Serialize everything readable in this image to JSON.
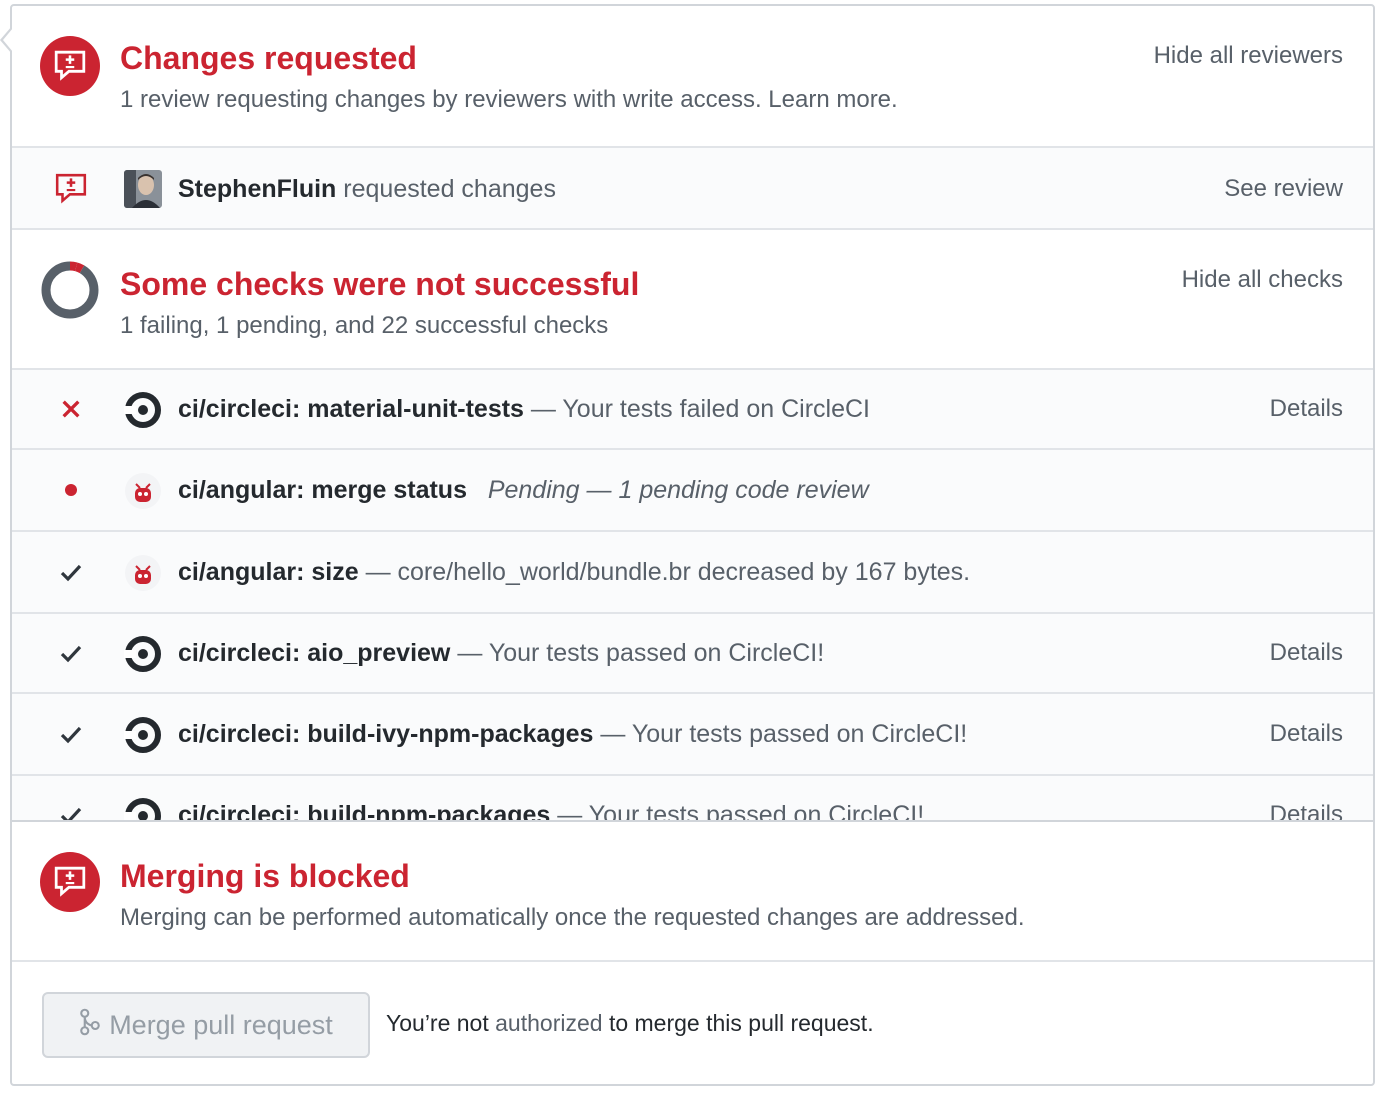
{
  "reviews": {
    "title": "Changes requested",
    "subtitle_main": "1 review requesting changes by reviewers with write access.",
    "subtitle_link": "Learn more.",
    "toggle_label": "Hide all reviewers",
    "icon": "file-diff-icon",
    "reviewer": {
      "username": "StephenFluin",
      "action": "requested changes",
      "link": "See review",
      "icon": "file-diff-icon"
    }
  },
  "checks": {
    "title": "Some checks were not successful",
    "subtitle": "1 failing, 1 pending, and 22 successful checks",
    "toggle_label": "Hide all checks",
    "donut": {
      "failing": 1,
      "pending": 1,
      "successful": 22
    },
    "items": [
      {
        "status": "failure",
        "app": "circleci",
        "context": "ci/circleci: material-unit-tests",
        "separator": " — ",
        "description": "Your tests failed on CircleCI",
        "italic": false,
        "details": "Details"
      },
      {
        "status": "pending",
        "app": "angular",
        "context": "ci/angular: merge status",
        "separator": "   ",
        "description": "Pending — 1 pending code review",
        "italic": true,
        "details": ""
      },
      {
        "status": "success",
        "app": "angular",
        "context": "ci/angular: size",
        "separator": " — ",
        "description": "core/hello_world/bundle.br decreased by 167 bytes.",
        "italic": false,
        "details": ""
      },
      {
        "status": "success",
        "app": "circleci",
        "context": "ci/circleci: aio_preview",
        "separator": " — ",
        "description": "Your tests passed on CircleCI!",
        "italic": false,
        "details": "Details"
      },
      {
        "status": "success",
        "app": "circleci",
        "context": "ci/circleci: build-ivy-npm-packages",
        "separator": " — ",
        "description": "Your tests passed on CircleCI!",
        "italic": false,
        "details": "Details"
      },
      {
        "status": "success",
        "app": "circleci",
        "context": "ci/circleci: build-npm-packages",
        "separator": " — ",
        "description": "Your tests passed on CircleCI!",
        "italic": false,
        "details": "Details"
      }
    ]
  },
  "merge": {
    "title": "Merging is blocked",
    "subtitle": "Merging can be performed automatically once the requested changes are addressed.",
    "icon": "file-diff-icon",
    "button_label": "Merge pull request",
    "auth_before": "You’re not ",
    "auth_link": "authorized",
    "auth_after": " to merge this pull request."
  },
  "colors": {
    "danger": "#cb2431",
    "muted": "#586069",
    "success": "#2f363d",
    "donut_success": "#586069"
  }
}
